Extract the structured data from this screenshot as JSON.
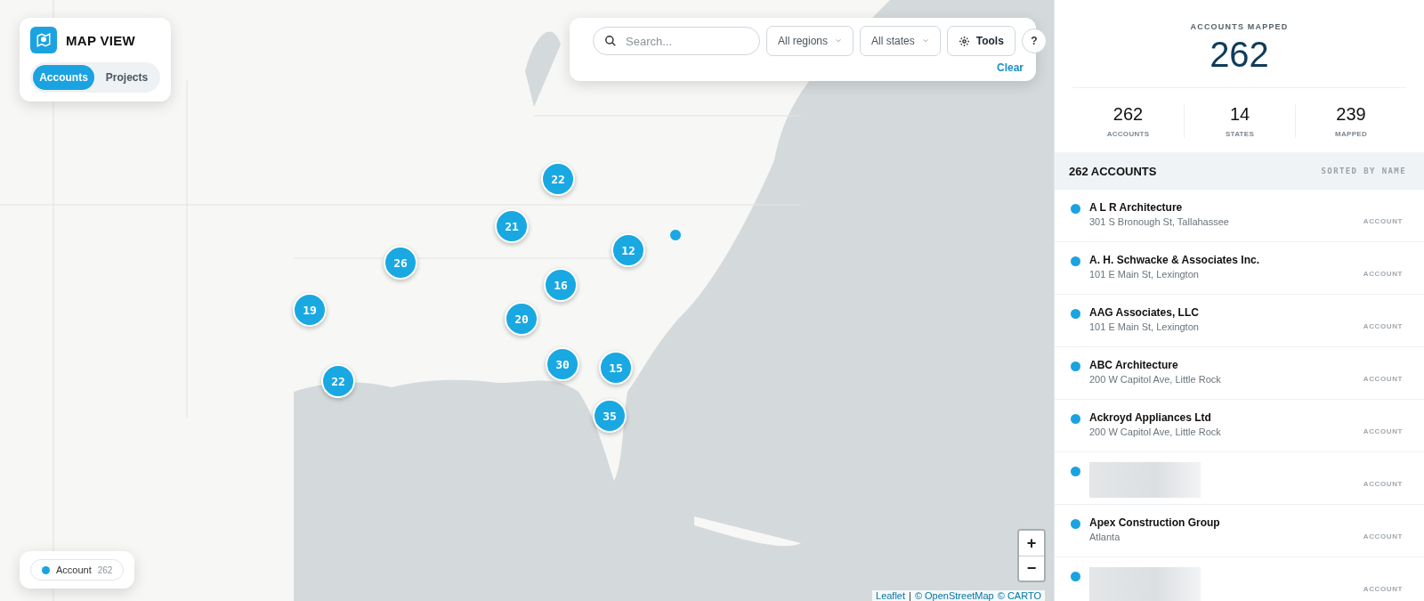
{
  "app": {
    "title": "MAP VIEW",
    "tabs": [
      {
        "label": "Accounts",
        "selected": true
      },
      {
        "label": "Projects",
        "selected": false
      }
    ]
  },
  "filters": {
    "search": {
      "placeholder": "Search..."
    },
    "dropdowns": [
      "All regions",
      "All states"
    ],
    "tools": "Tools",
    "help": "?",
    "clear": "Clear"
  },
  "map": {
    "clusters": [
      {
        "count": "22"
      },
      {
        "count": "21"
      },
      {
        "count": "12"
      },
      {
        "count": "26"
      },
      {
        "count": "16"
      },
      {
        "count": "19"
      },
      {
        "count": "20"
      },
      {
        "count": "30"
      },
      {
        "count": "15"
      },
      {
        "count": "22"
      },
      {
        "count": "35"
      }
    ],
    "markers": [
      {
        "kind": "single"
      }
    ],
    "zoom": {
      "in": "+",
      "out": "−"
    },
    "legend": [
      {
        "label": "Account",
        "count": "262",
        "color": "#1aa3e0"
      }
    ],
    "attribution": [
      "Leaflet",
      "|",
      "© OpenStreetMap",
      "© CARTO"
    ]
  },
  "summary": {
    "title": "ACCOUNTS MAPPED",
    "total": "262",
    "stats": [
      {
        "value": "262",
        "label": "ACCOUNTS"
      },
      {
        "value": "14",
        "label": "STATES"
      },
      {
        "value": "239",
        "label": "MAPPED"
      }
    ]
  },
  "list": {
    "title": "262 ACCOUNTS",
    "sort": "SORTED BY NAME",
    "items": [
      {
        "kind": "account",
        "name": "A L R Architecture",
        "address": "301 S Bronough St, Tallahassee",
        "type": "ACCOUNT",
        "color": "#1aa3e0"
      },
      {
        "kind": "account",
        "name": "A. H. Schwacke & Associates Inc.",
        "address": "101 E Main St, Lexington",
        "type": "ACCOUNT",
        "color": "#1aa3e0"
      },
      {
        "kind": "account",
        "name": "AAG Associates, LLC",
        "address": "101 E Main St, Lexington",
        "type": "ACCOUNT",
        "color": "#1aa3e0"
      },
      {
        "kind": "account",
        "name": "ABC Architecture",
        "address": "200 W Capitol Ave, Little Rock",
        "type": "ACCOUNT",
        "color": "#1aa3e0"
      },
      {
        "kind": "account",
        "name": "Ackroyd Appliances Ltd",
        "address": "200 W Capitol Ave, Little Rock",
        "type": "ACCOUNT",
        "color": "#1aa3e0"
      },
      {
        "kind": "redacted",
        "type": "ACCOUNT",
        "color": "#1aa3e0"
      },
      {
        "kind": "account",
        "name": "Apex Construction Group",
        "address": "Atlanta",
        "type": "ACCOUNT",
        "color": "#1aa3e0"
      },
      {
        "kind": "redacted",
        "type": "ACCOUNT",
        "color": "#1aa3e0"
      }
    ]
  }
}
